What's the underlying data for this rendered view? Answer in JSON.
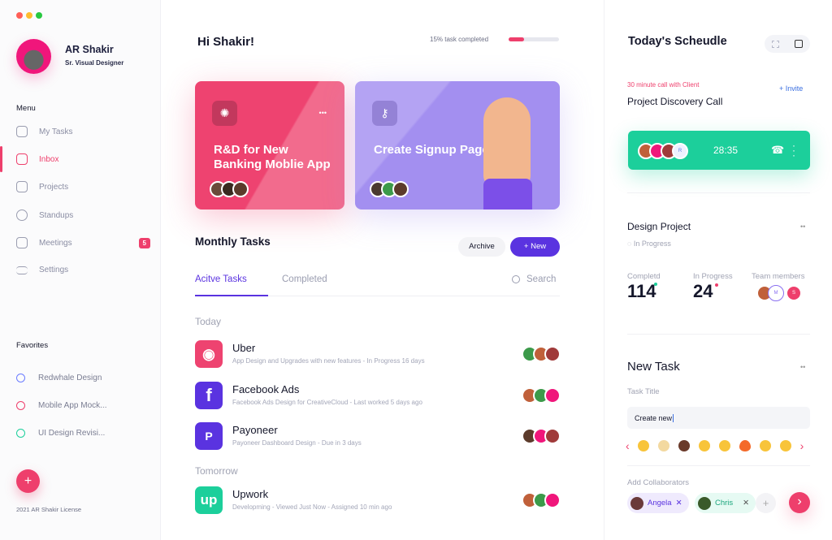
{
  "window_controls": {
    "close": "#ff5f57",
    "minimize": "#febc2e",
    "maximize": "#28c840"
  },
  "profile": {
    "name": "AR Shakir",
    "role": "Sr. Visual Designer"
  },
  "menu": {
    "heading": "Menu",
    "items": [
      {
        "label": "My Tasks",
        "icon": "inbox-tray-icon"
      },
      {
        "label": "Inbox",
        "icon": "chat-icon",
        "active": true
      },
      {
        "label": "Projects",
        "icon": "hash-icon"
      },
      {
        "label": "Standups",
        "icon": "clock-icon"
      },
      {
        "label": "Meetings",
        "icon": "calendar-icon",
        "badge": "5"
      },
      {
        "label": "Settings",
        "icon": "sliders-icon"
      }
    ]
  },
  "favorites": {
    "heading": "Favorites",
    "items": [
      {
        "label": "Redwhale Design",
        "color": "#6b7cff"
      },
      {
        "label": "Mobile App Mock...",
        "color": "#ee3f6c"
      },
      {
        "label": "UI Design Revisi...",
        "color": "#1ccf9b"
      }
    ]
  },
  "footer": {
    "license": "2021 AR Shakir License",
    "add": "+"
  },
  "header": {
    "greeting": "Hi Shakir!",
    "progress_text": "15% task completed",
    "progress": 0.15
  },
  "cards": [
    {
      "title": "R&D for New Banking Moblie App",
      "icon": "lightbulb-icon",
      "more": "•••",
      "color": "#ee4370"
    },
    {
      "title": "Create Signup Page",
      "icon": "key-icon",
      "color": "#a38ff0"
    }
  ],
  "monthly": {
    "title": "Monthly Tasks",
    "archive": "Archive",
    "new": "+ New",
    "tabs": [
      "Acitve Tasks",
      "Completed"
    ],
    "search_placeholder": "Search",
    "today": "Today",
    "tomorrow": "Tomorrow",
    "tasks": [
      {
        "name": "Uber",
        "desc": "App Design and Upgrades with new features - In Progress 16 days",
        "color": "#ee4370",
        "glyph": "◉"
      },
      {
        "name": "Facebook Ads",
        "desc": "Facebook Ads Design for CreativeCloud - Last worked 5 days ago",
        "color": "#5a33e0",
        "glyph": "f"
      },
      {
        "name": "Payoneer",
        "desc": "Payoneer Dashboard Design - Due in 3 days",
        "color": "#5a33e0",
        "glyph": "P"
      },
      {
        "name": "Upwork",
        "desc": "Developming - Viewed Just Now - Assigned 10 min ago",
        "color": "#1ccf9b",
        "glyph": "up"
      }
    ]
  },
  "schedule": {
    "title": "Today's Scheudle",
    "call_tag": "30 minute call with Client",
    "call_title": "Project Discovery Call",
    "invite": "+ Invite",
    "timer": "28:35",
    "extra_avatar": "R"
  },
  "design_project": {
    "title": "Design Project",
    "more": "••",
    "status": "In Progress",
    "completed_label": "Completd",
    "completed": "114",
    "progress_label": "In Progress",
    "progress": "24",
    "team_label": "Team members",
    "team": [
      "M",
      "S"
    ]
  },
  "new_task": {
    "title": "New Task",
    "more": "••",
    "field_label": "Task Title",
    "value": "Create new",
    "emojis": [
      "cowboy-face",
      "party-popper",
      "woman",
      "astonished",
      "grinning",
      "fire",
      "beaming",
      "winking"
    ],
    "collab_label": "Add Collaborators",
    "collaborators": [
      {
        "name": "Angela",
        "remove": "✕"
      },
      {
        "name": "Chris",
        "remove": "✕"
      }
    ],
    "add": "+",
    "submit": "›"
  }
}
